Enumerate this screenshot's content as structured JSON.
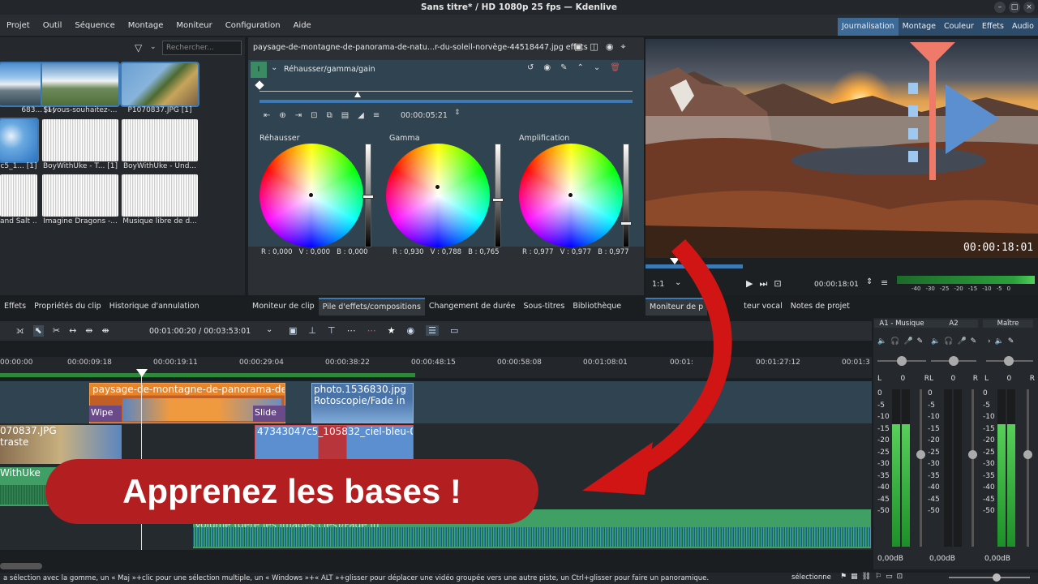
{
  "window": {
    "title": "Sans titre* / HD 1080p 25 fps — Kdenlive"
  },
  "menu": [
    "Projet",
    "Outil",
    "Séquence",
    "Montage",
    "Moniteur",
    "Configuration",
    "Aide"
  ],
  "workspaces": [
    "Journalisation",
    "Montage",
    "Couleur",
    "Effets",
    "Audio"
  ],
  "bin": {
    "search_placeholder": "Rechercher...",
    "items": [
      {
        "label": "683... [1]",
        "kind": "mountain"
      },
      {
        "label": "Si-vous-souhaitez-...",
        "kind": "valley"
      },
      {
        "label": "P1070837.JPG [1]",
        "kind": "pine"
      },
      {
        "label": "c5_1... [1]",
        "kind": "sky"
      },
      {
        "label": "BoyWithUke - T... [1]",
        "kind": "audio"
      },
      {
        "label": "BoyWithUke - Und...",
        "kind": "audio"
      },
      {
        "label": "and Salt ...",
        "kind": "audio"
      },
      {
        "label": "Imagine Dragons -...",
        "kind": "audio"
      },
      {
        "label": "Musique libre de d...",
        "kind": "audio"
      }
    ]
  },
  "effects": {
    "clip_name": "paysage-de-montagne-de-panorama-de-natu...r-du-soleil-norvège-44518447.jpg effets",
    "effect_name": "Réhausser/gamma/gain",
    "timecode": "00:00:05:21",
    "wheels": [
      {
        "title": "Réhausser",
        "values": "R : 0,000   V : 0,000   B : 0,000",
        "slider": 0.5
      },
      {
        "title": "Gamma",
        "values": "R : 0,930   V : 0,788   B : 0,765",
        "slider": 0.55
      },
      {
        "title": "Amplification",
        "values": "R : 0,977   V : 0,977   B : 0,977",
        "slider": 0.75
      }
    ]
  },
  "monitor": {
    "timecode_overlay": "00:00:18:01",
    "zoom": "1:1",
    "position": "00:00:18:01",
    "scale_labels": [
      "-40",
      "-30",
      "-25",
      "-20",
      "-15",
      "-10",
      "-5",
      "0"
    ]
  },
  "tabs_left": [
    "Effets",
    "Propriétés du clip",
    "Historique d'annulation"
  ],
  "tabs_mid": [
    "Moniteur de clip",
    "Pile d'effets/compositions",
    "Changement de durée",
    "Sous-titres",
    "Bibliothèque"
  ],
  "tabs_right": [
    "Moniteur de p",
    "teur vocal",
    "Notes de projet"
  ],
  "timeline": {
    "position": "00:01:00:20 / 00:03:53:01",
    "ruler": [
      "00:00:00",
      "00:00:09:18",
      "00:00:19:11",
      "00:00:29:04",
      "00:00:38:22",
      "00:00:48:15",
      "00:00:58:08",
      "00:01:08:01",
      "00:01:",
      "00:01:27:12",
      "00:01:3"
    ],
    "clips": {
      "v2_a": "paysage-de-montagne-de-panorama-de",
      "v2_b_title": "photo.1536830.jpg",
      "v2_b_effect": "Rotoscopie/Fade in",
      "wipe": "Wipe",
      "slide": "Slide",
      "v1_a_title": "070837.JPG",
      "v1_a_effect": "traste",
      "v1_b": "47343047c5_105832_ciel-bleu-0",
      "a1": "WithUke",
      "a2": "Volume (gère les images clés)/Fade in"
    }
  },
  "mixer": {
    "channels": [
      {
        "name": "A1 - Musique",
        "pan_l": "L",
        "pan_val": "0",
        "pan_r": "R",
        "db": "0,00dB",
        "level": 0.78
      },
      {
        "name": "A2",
        "pan_l": "L",
        "pan_val": "0",
        "pan_r": "R",
        "db": "0,00dB",
        "level": 0.0
      },
      {
        "name": "Maître",
        "pan_l": "L",
        "pan_val": "0",
        "pan_r": "R",
        "db": "0,00dB",
        "level": 0.78
      }
    ],
    "scale": [
      "0",
      "-5",
      "-10",
      "-15",
      "-20",
      "-25",
      "-30",
      "-35",
      "-40",
      "-45",
      "-50"
    ]
  },
  "banner": "Apprenez les bases !",
  "status": {
    "hint": "a sélection avec la gomme, un « Maj »+clic pour une sélection multiple, un « Windows »+« ALT »+glisser pour déplacer une vidéo groupée vers une autre piste, un Ctrl+glisser pour faire un panoramique.",
    "mode": "sélectionne"
  },
  "colors": {
    "accent": "#3d7ab5",
    "banner": "#b31e20",
    "arrow": "#d11414",
    "clip_orange": "#e8852c",
    "clip_blue": "#4a74a8",
    "clip_red": "#b8363b",
    "audio_green": "#3f9f65"
  }
}
